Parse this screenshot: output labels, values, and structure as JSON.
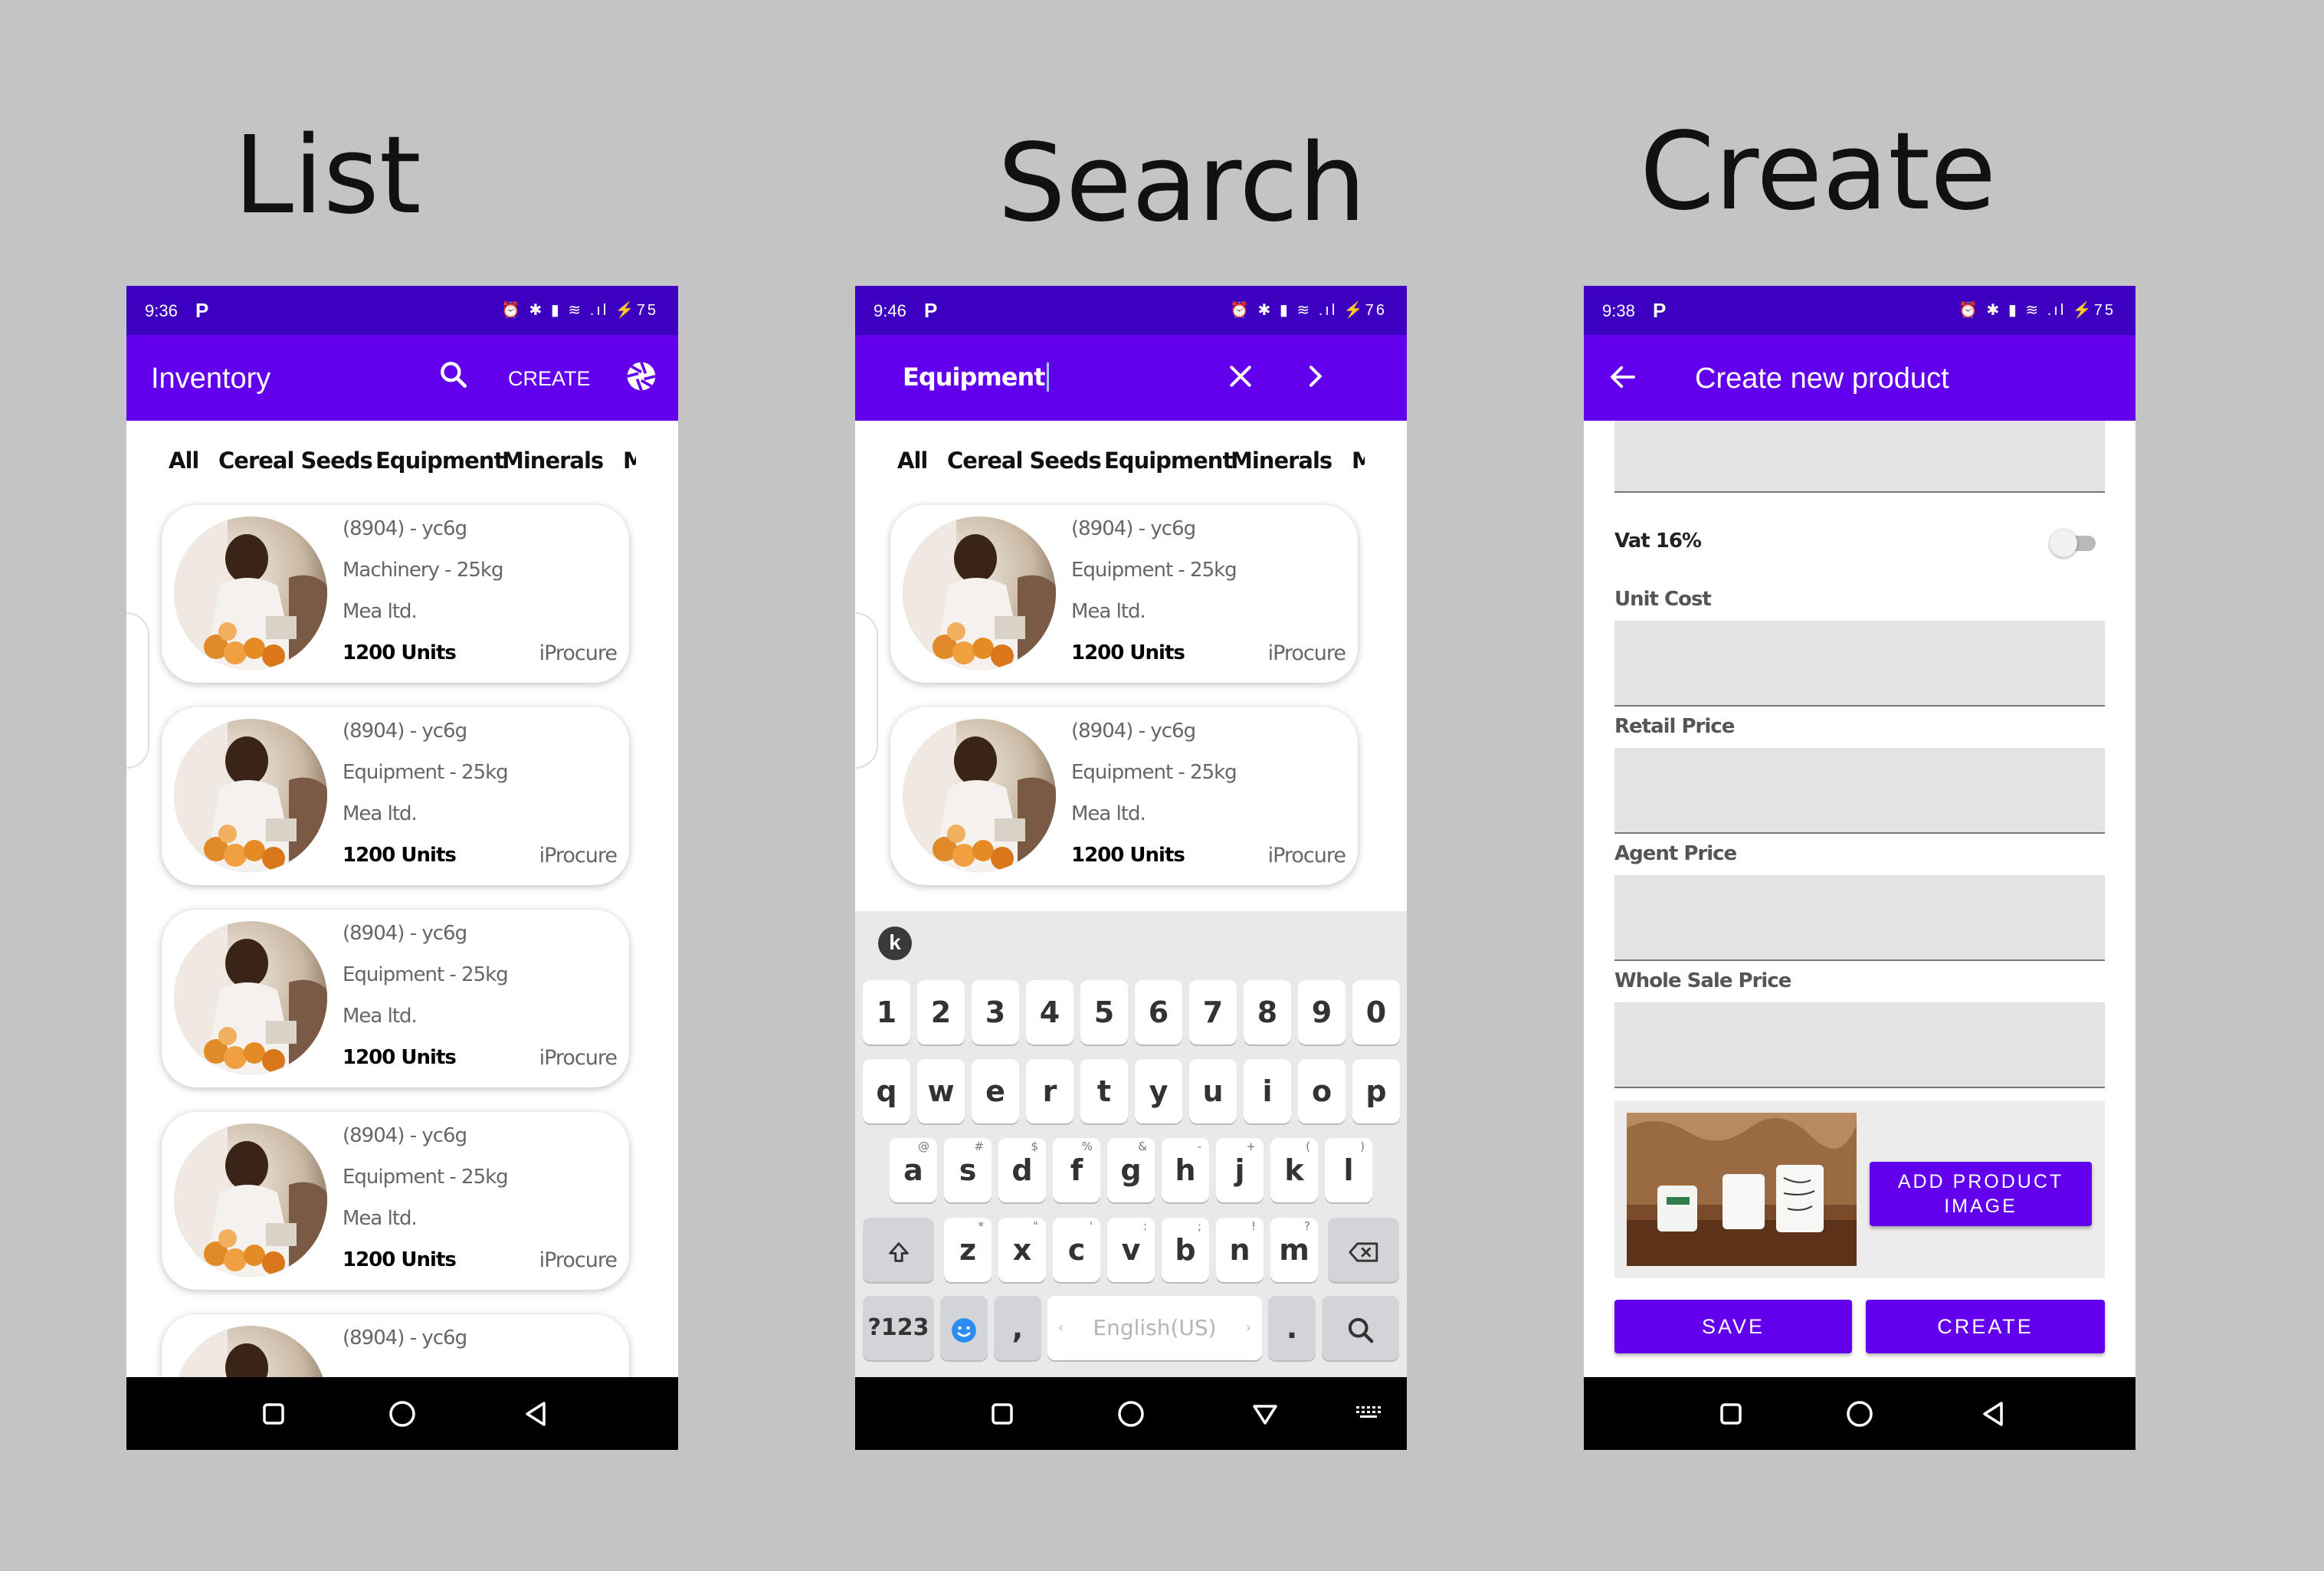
{
  "headings": {
    "list": "List",
    "search": "Search",
    "create": "Create"
  },
  "colors": {
    "statusbar": "#3d00c0",
    "appbar": "#6200ee",
    "background": "#c4c4c4"
  },
  "list_screen": {
    "status_time": "9:36",
    "status_icons": "⏰ ✱ ▮ ≋ .ıl ⚡75",
    "title": "Inventory",
    "create_label": "CREATE",
    "categories": [
      "All",
      "Cereal Seeds",
      "Equipment",
      "Minerals",
      "Ma"
    ],
    "items": [
      {
        "code": "(8904)  -  yc6g",
        "type": "Machinery  -  25kg",
        "company": "Mea ltd.",
        "units": "1200 Units",
        "brand": "iProcure"
      },
      {
        "code": "(8904)  -  yc6g",
        "type": "Equipment  -  25kg",
        "company": "Mea ltd.",
        "units": "1200 Units",
        "brand": "iProcure"
      },
      {
        "code": "(8904)  -  yc6g",
        "type": "Equipment  -  25kg",
        "company": "Mea ltd.",
        "units": "1200 Units",
        "brand": "iProcure"
      },
      {
        "code": "(8904)  -  yc6g",
        "type": "Equipment  -  25kg",
        "company": "Mea ltd.",
        "units": "1200 Units",
        "brand": "iProcure"
      },
      {
        "code": "(8904)  -  yc6g"
      }
    ]
  },
  "search_screen": {
    "status_time": "9:46",
    "status_icons": "⏰ ✱ ▮ ≋ .ıl ⚡76",
    "query": "Equipment",
    "categories": [
      "All",
      "Cereal Seeds",
      "Equipment",
      "Minerals",
      "Ma"
    ],
    "items": [
      {
        "code": "(8904)  -  yc6g",
        "type": "Equipment  -  25kg",
        "company": "Mea ltd.",
        "units": "1200 Units",
        "brand": "iProcure"
      },
      {
        "code": "(8904)  -  yc6g",
        "type": "Equipment  -  25kg",
        "company": "Mea ltd.",
        "units": "1200 Units",
        "brand": "iProcure"
      }
    ],
    "keyboard": {
      "logo": "k",
      "row_numbers": [
        "1",
        "2",
        "3",
        "4",
        "5",
        "6",
        "7",
        "8",
        "9",
        "0"
      ],
      "row1": [
        "q",
        "w",
        "e",
        "r",
        "t",
        "y",
        "u",
        "i",
        "o",
        "p"
      ],
      "row2": [
        "a",
        "s",
        "d",
        "f",
        "g",
        "h",
        "j",
        "k",
        "l"
      ],
      "row2_hints": [
        "@",
        "#",
        "$",
        "%",
        "&",
        "-",
        "+",
        "(",
        ")"
      ],
      "row3": [
        "z",
        "x",
        "c",
        "v",
        "b",
        "n",
        "m"
      ],
      "row3_hints": [
        "*",
        "\"",
        "'",
        ":",
        ";",
        "!",
        "?"
      ],
      "sym_label": "?123",
      "comma": ",",
      "space_label": "English(US)",
      "period": "."
    }
  },
  "create_screen": {
    "status_time": "9:38",
    "status_icons": "⏰ ✱ ▮ ≋ .ıl ⚡75",
    "title": "Create new product",
    "vat_label": "Vat 16%",
    "fields": [
      "Unit Cost",
      "Retail Price",
      "Agent Price",
      "Whole Sale Price"
    ],
    "add_image_label": "ADD PRODUCT IMAGE",
    "save_label": "SAVE",
    "create_label": "CREATE"
  }
}
